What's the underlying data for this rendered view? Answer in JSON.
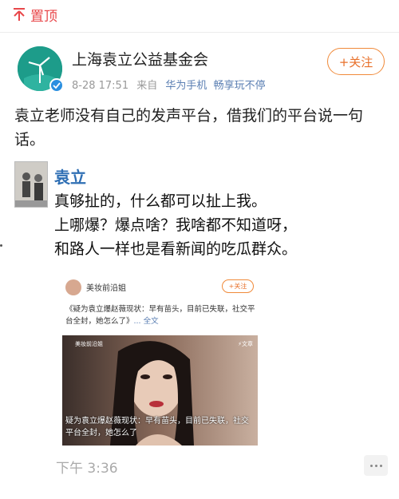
{
  "topbar": {
    "pin_label": "置顶",
    "pin_icon": "pin-top-icon",
    "accent": "#e8474a"
  },
  "account": {
    "name": "上海袁立公益基金会",
    "timestamp": "8-28 17:51",
    "from_label": "来自",
    "device": "华为手机",
    "device_suffix": "畅享玩不停",
    "follow_label": "+关注"
  },
  "post": {
    "text": "袁立老师没有自己的发声平台，借我们的平台说一句话。"
  },
  "quote": {
    "name": "袁立",
    "lines": [
      "真够扯的，什么都可以扯上我。",
      "上哪爆？爆点啥？我啥都不知道呀，",
      "和路人一样也是看新闻的吃瓜群众。"
    ]
  },
  "card": {
    "name": "美妆前沿姐",
    "follow_label": "+关注",
    "text": "《疑为袁立爆赵薇现状：早有苗头，目前已失联，社交平台全封，她怎么了》",
    "more": "... 全文",
    "image_watermark": "美妆前沿姐",
    "image_tag": "⚡文章",
    "image_caption": "疑为袁立爆赵薇现状：早有苗头，目前已失联，社交平台全封，她怎么了"
  },
  "footer": {
    "time": "下午 3:36"
  }
}
